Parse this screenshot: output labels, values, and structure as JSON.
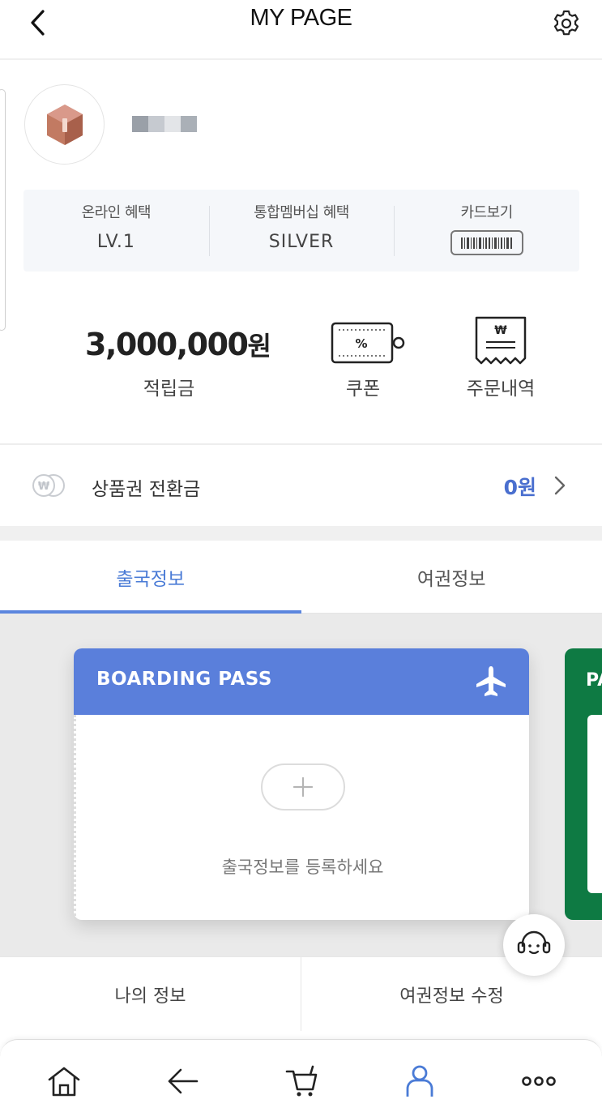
{
  "header": {
    "title": "MY PAGE",
    "back_icon": "chevron-left-icon",
    "settings_icon": "gear-icon"
  },
  "profile": {
    "avatar_icon": "bronze-hexagon-icon",
    "username": ""
  },
  "benefits": [
    {
      "label": "온라인 혜택",
      "value": "LV.1"
    },
    {
      "label": "통합멤버십 혜택",
      "value": "SILVER"
    },
    {
      "label": "카드보기",
      "icon": "barcode-icon"
    }
  ],
  "stats": {
    "points_amount": "3,000,000",
    "points_unit": "원",
    "points_label": "적립금",
    "coupon_label": "쿠폰",
    "coupon_icon": "coupon-icon",
    "order_label": "주문내역",
    "order_icon": "receipt-won-icon"
  },
  "gift": {
    "label": "상품권 전환금",
    "value": "0원",
    "icon": "won-coin-icon"
  },
  "tabs": [
    {
      "label": "출국정보",
      "active": true
    },
    {
      "label": "여권정보",
      "active": false
    }
  ],
  "boarding": {
    "title": "BOARDING PASS",
    "message": "출국정보를 등록하세요",
    "icon": "airplane-icon"
  },
  "passport": {
    "title": "PA"
  },
  "menu": [
    {
      "label": "나의 정보"
    },
    {
      "label": "여권정보 수정"
    }
  ],
  "nav": [
    "home-icon",
    "back-arrow-icon",
    "cart-icon",
    "person-icon",
    "more-icon"
  ],
  "colors": {
    "accent": "#4a7bd6",
    "boarding_header": "#5a7fdb",
    "passport_green": "#0e7a43",
    "avatar_bronze": "#c27a62"
  }
}
